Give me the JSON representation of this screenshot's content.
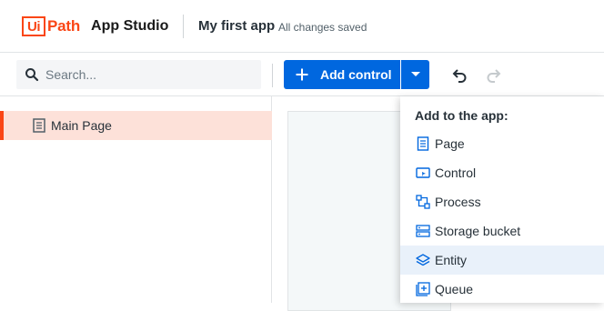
{
  "header": {
    "logo_ui": "Ui",
    "logo_path": "Path",
    "product": "App Studio",
    "app_name": "My first app",
    "save_status": "All changes saved"
  },
  "toolbar": {
    "search_placeholder": "Search...",
    "add_control_label": "Add control"
  },
  "pages": [
    {
      "label": "Main Page",
      "selected": true
    }
  ],
  "add_menu": {
    "heading": "Add to the app:",
    "items": [
      {
        "label": "Page",
        "icon": "page-icon"
      },
      {
        "label": "Control",
        "icon": "control-icon"
      },
      {
        "label": "Process",
        "icon": "process-icon"
      },
      {
        "label": "Storage bucket",
        "icon": "storage-bucket-icon"
      },
      {
        "label": "Entity",
        "icon": "entity-icon",
        "highlighted": true
      },
      {
        "label": "Queue",
        "icon": "queue-icon"
      }
    ]
  },
  "colors": {
    "brand": "#fa4616",
    "primary": "#0067df",
    "selected_bg": "#fde1d9",
    "hover_bg": "#e9f1fa"
  }
}
